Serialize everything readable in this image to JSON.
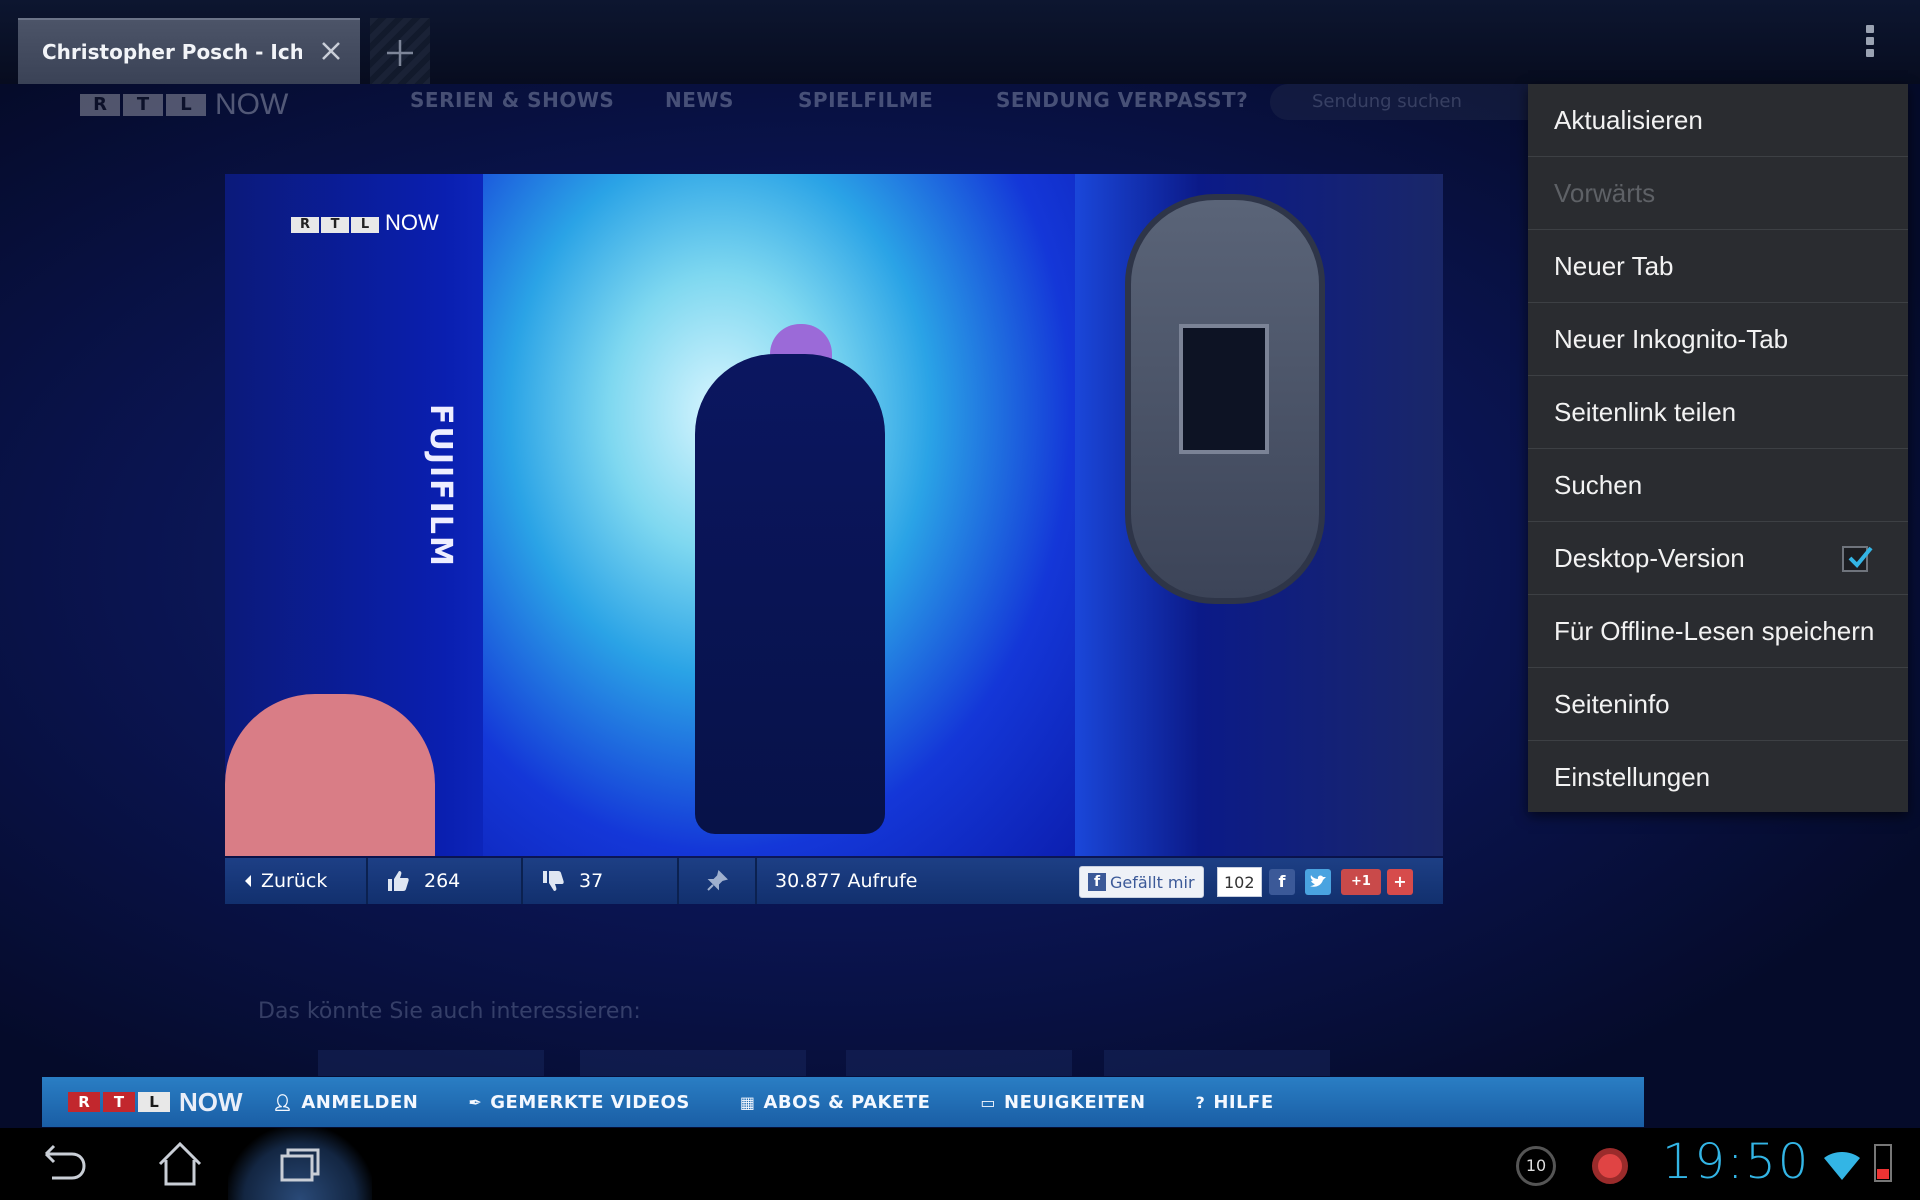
{
  "browser": {
    "tab_title": "Christopher Posch - Ich ...",
    "menu": {
      "items": [
        {
          "label": "Aktualisieren",
          "enabled": true
        },
        {
          "label": "Vorwärts",
          "enabled": false
        },
        {
          "label": "Neuer Tab",
          "enabled": true
        },
        {
          "label": "Neuer Inkognito-Tab",
          "enabled": true
        },
        {
          "label": "Seitenlink teilen",
          "enabled": true
        },
        {
          "label": "Suchen",
          "enabled": true
        },
        {
          "label": "Desktop-Version",
          "enabled": true,
          "checked": true
        },
        {
          "label": "Für Offline-Lesen speichern",
          "enabled": true
        },
        {
          "label": "Seiteninfo",
          "enabled": true
        },
        {
          "label": "Einstellungen",
          "enabled": true
        }
      ]
    }
  },
  "site": {
    "logo_letters": [
      "R",
      "T",
      "L"
    ],
    "logo_word": "NOW",
    "nav": [
      "SERIEN & SHOWS",
      "NEWS",
      "SPIELFILME",
      "SENDUNG VERPASST?"
    ],
    "search_placeholder": "Sendung suchen",
    "video": {
      "brand_text": "FUJIFILM"
    },
    "player": {
      "back_label": "Zurück",
      "likes": "264",
      "dislikes": "37",
      "views": "30.877 Aufrufe",
      "fb_like_label": "Gefällt mir",
      "fb_count": "102",
      "gplus_label": "+1"
    },
    "suggest_heading": "Das könnte Sie auch interessieren:",
    "bottom_bar": {
      "items": [
        {
          "icon": "user-icon",
          "label": "ANMELDEN"
        },
        {
          "icon": "pin-icon",
          "label": "GEMERKTE VIDEOS"
        },
        {
          "icon": "grid-icon",
          "label": "ABOS & PAKETE"
        },
        {
          "icon": "chat-icon",
          "label": "NEUIGKEITEN"
        },
        {
          "icon": "help-icon",
          "label": "HILFE"
        }
      ]
    }
  },
  "system_bar": {
    "badge": "10",
    "clock": "19:50",
    "accent_color": "#33b5e5"
  }
}
